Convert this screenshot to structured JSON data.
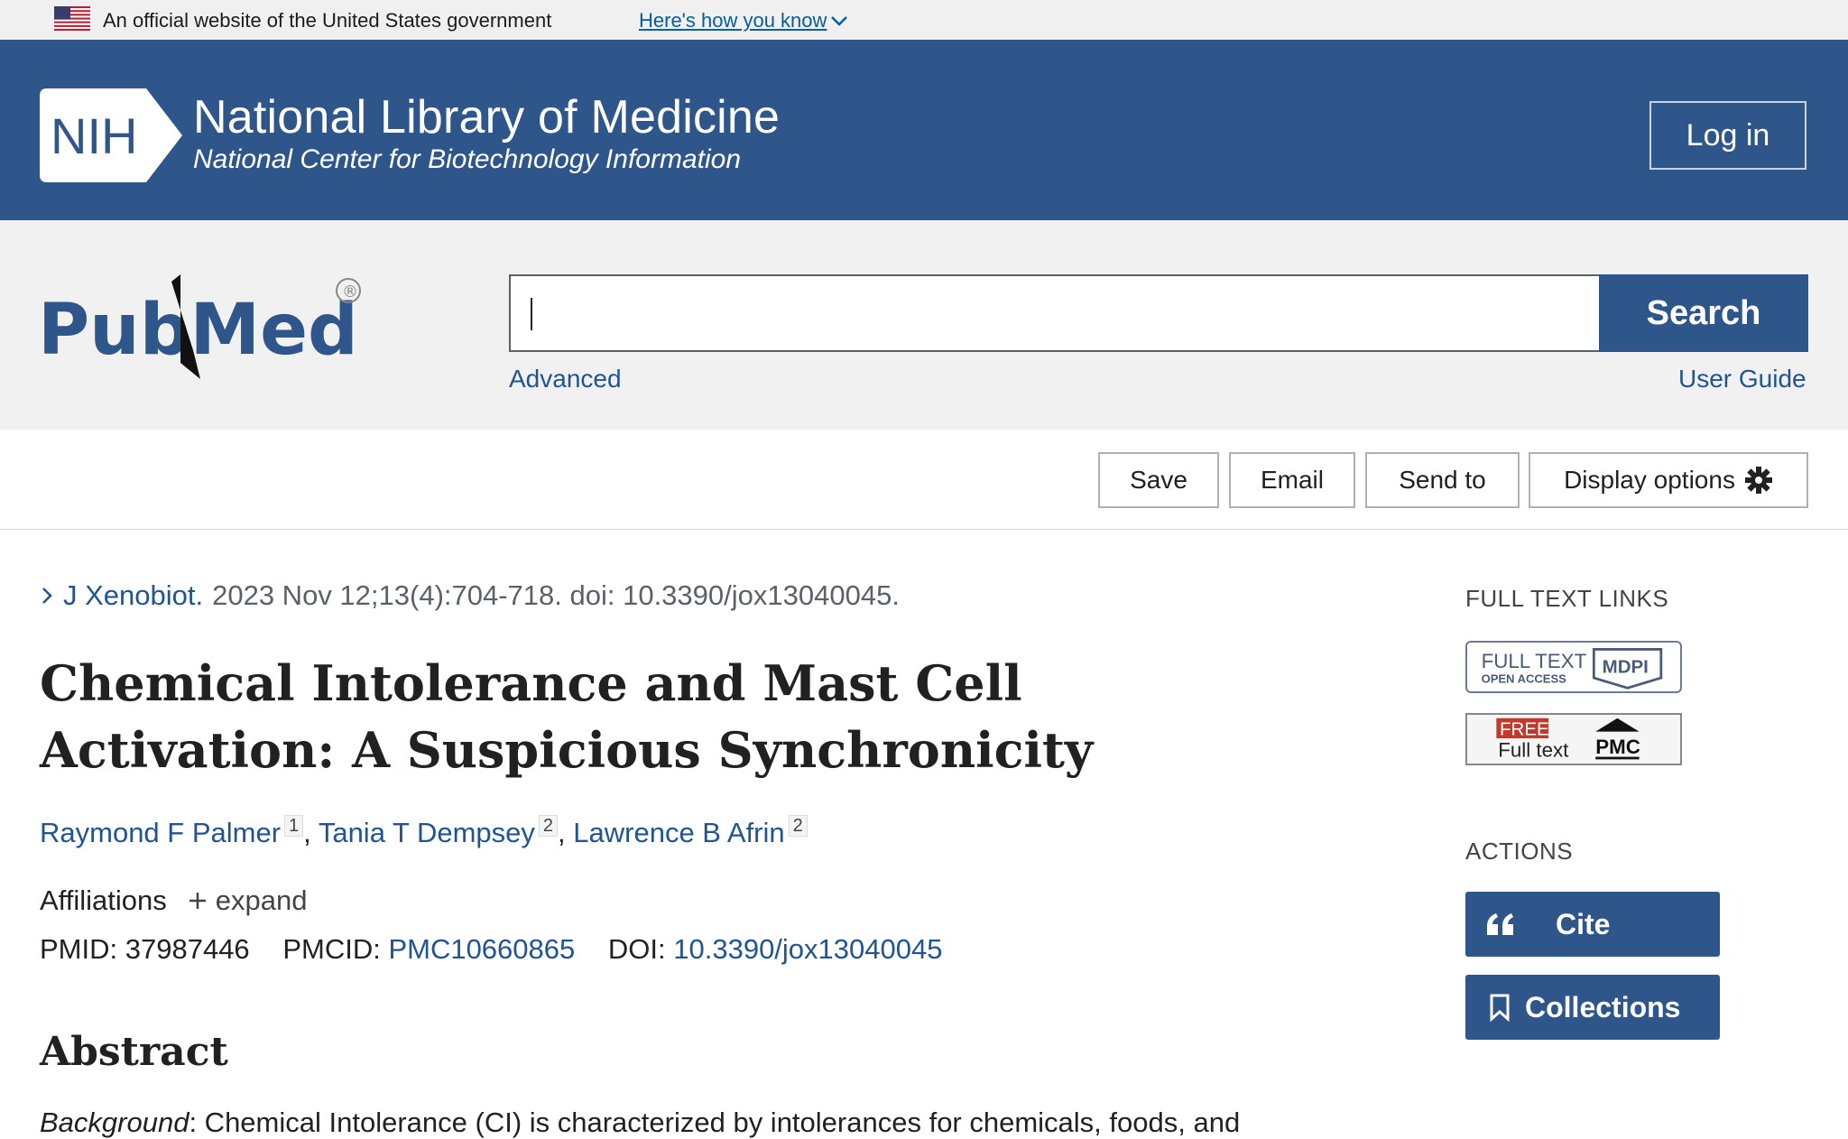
{
  "gov_banner": {
    "text": "An official website of the United States government",
    "link": "Here's how you know"
  },
  "header": {
    "logo_text": "NIH",
    "title": "National Library of Medicine",
    "subtitle": "National Center for Biotechnology Information",
    "login_label": "Log in"
  },
  "search": {
    "logo_text": "PubMed",
    "logo_mark": "®",
    "value": "",
    "placeholder": "",
    "button_label": "Search",
    "advanced_label": "Advanced",
    "guide_label": "User Guide"
  },
  "toolbar": {
    "save_label": "Save",
    "email_label": "Email",
    "send_label": "Send to",
    "display_label": "Display options"
  },
  "article": {
    "journal": "J Xenobiot.",
    "citation": "2023 Nov 12;13(4):704-718. doi: 10.3390/jox13040045.",
    "title": "Chemical Intolerance and Mast Cell Activation: A Suspicious Synchronicity",
    "authors": [
      {
        "name": "Raymond F Palmer",
        "aff": "1"
      },
      {
        "name": "Tania T Dempsey",
        "aff": "2"
      },
      {
        "name": "Lawrence B Afrin",
        "aff": "2"
      }
    ],
    "affiliations_label": "Affiliations",
    "expand_label": "expand",
    "pmid_label": "PMID:",
    "pmid": "37987446",
    "pmcid_label": "PMCID:",
    "pmcid": "PMC10660865",
    "doi_label": "DOI:",
    "doi": "10.3390/jox13040045",
    "abstract_heading": "Abstract",
    "abstract_lead": "Background",
    "abstract_text": ": Chemical Intolerance (CI) is characterized by intolerances for chemicals, foods, and"
  },
  "sidebar": {
    "full_text_heading": "FULL TEXT LINKS",
    "mdpi_top": "FULL TEXT",
    "mdpi_bottom": "OPEN ACCESS",
    "mdpi_brand": "MDPI",
    "pmc_free": "FREE",
    "pmc_full": "Full text",
    "pmc_brand": "PMC",
    "actions_heading": "ACTIONS",
    "cite_label": "Cite",
    "collections_label": "Collections"
  },
  "colors": {
    "nih_blue": "#2f568a",
    "link_blue": "#205493",
    "banner_gray": "#f0f0f0"
  }
}
